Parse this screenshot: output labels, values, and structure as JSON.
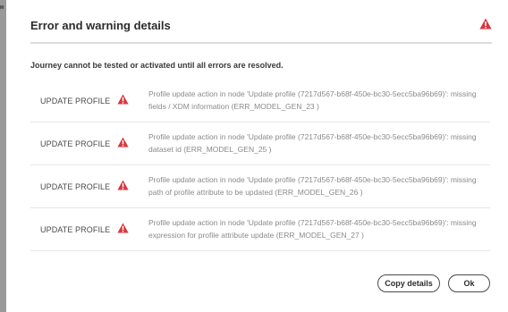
{
  "backdrop": {
    "fragment": "M"
  },
  "dialog": {
    "title": "Error and warning details",
    "subtitle": "Journey cannot be tested or activated until all errors are resolved.",
    "icons": {
      "title": "warning-icon",
      "row": "warning-icon"
    },
    "colors": {
      "warning": "#d7373f"
    },
    "errors": [
      {
        "label": "UPDATE PROFILE",
        "message": "Profile update action in node 'Update profile (7217d567-b68f-450e-bc30-5ecc5ba96b69)': missing fields / XDM information (ERR_MODEL_GEN_23 )"
      },
      {
        "label": "UPDATE PROFILE",
        "message": "Profile update action in node 'Update profile (7217d567-b68f-450e-bc30-5ecc5ba96b69)': missing dataset id (ERR_MODEL_GEN_25 )"
      },
      {
        "label": "UPDATE PROFILE",
        "message": "Profile update action in node 'Update profile (7217d567-b68f-450e-bc30-5ecc5ba96b69)': missing path of profile attribute to be updated (ERR_MODEL_GEN_26 )"
      },
      {
        "label": "UPDATE PROFILE",
        "message": "Profile update action in node 'Update profile (7217d567-b68f-450e-bc30-5ecc5ba96b69)': missing expression for profile attribute update (ERR_MODEL_GEN_27 )"
      }
    ],
    "buttons": {
      "copy": "Copy details",
      "ok": "Ok"
    }
  }
}
